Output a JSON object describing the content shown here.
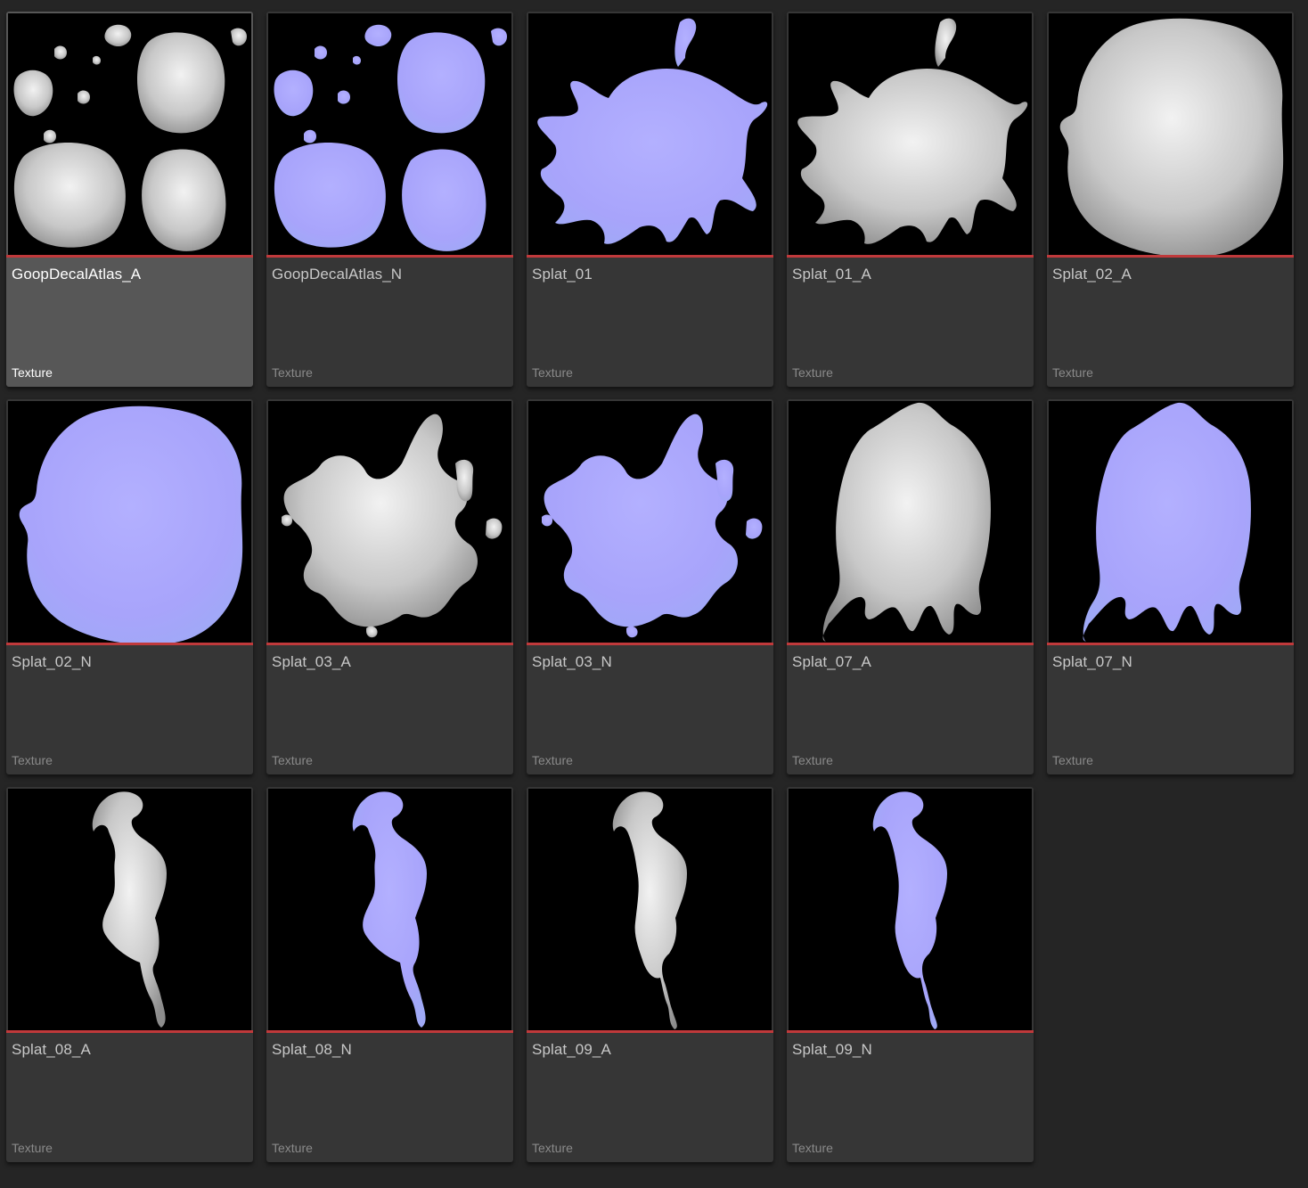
{
  "accent": {
    "texture_bar": "#c0393b",
    "selected_tile": "#575757",
    "tile": "#363636",
    "background": "#252525",
    "normal_map_tint": "#a9a6ff",
    "alpha_map_tint": "#d8d8d8"
  },
  "assets": [
    {
      "name": "GoopDecalAtlas_A",
      "type": "Texture",
      "selected": true,
      "map": "alpha",
      "shape": "atlas"
    },
    {
      "name": "GoopDecalAtlas_N",
      "type": "Texture",
      "selected": false,
      "map": "normal",
      "shape": "atlas"
    },
    {
      "name": "Splat_01",
      "type": "Texture",
      "selected": false,
      "map": "normal",
      "shape": "splat01"
    },
    {
      "name": "Splat_01_A",
      "type": "Texture",
      "selected": false,
      "map": "alpha",
      "shape": "splat01"
    },
    {
      "name": "Splat_02_A",
      "type": "Texture",
      "selected": false,
      "map": "alpha",
      "shape": "splat02"
    },
    {
      "name": "Splat_02_N",
      "type": "Texture",
      "selected": false,
      "map": "normal",
      "shape": "splat02"
    },
    {
      "name": "Splat_03_A",
      "type": "Texture",
      "selected": false,
      "map": "alpha",
      "shape": "splat03"
    },
    {
      "name": "Splat_03_N",
      "type": "Texture",
      "selected": false,
      "map": "normal",
      "shape": "splat03"
    },
    {
      "name": "Splat_07_A",
      "type": "Texture",
      "selected": false,
      "map": "alpha",
      "shape": "splat07"
    },
    {
      "name": "Splat_07_N",
      "type": "Texture",
      "selected": false,
      "map": "normal",
      "shape": "splat07"
    },
    {
      "name": "Splat_08_A",
      "type": "Texture",
      "selected": false,
      "map": "alpha",
      "shape": "splat08"
    },
    {
      "name": "Splat_08_N",
      "type": "Texture",
      "selected": false,
      "map": "normal",
      "shape": "splat08"
    },
    {
      "name": "Splat_09_A",
      "type": "Texture",
      "selected": false,
      "map": "alpha",
      "shape": "splat09"
    },
    {
      "name": "Splat_09_N",
      "type": "Texture",
      "selected": false,
      "map": "normal",
      "shape": "splat09"
    }
  ]
}
